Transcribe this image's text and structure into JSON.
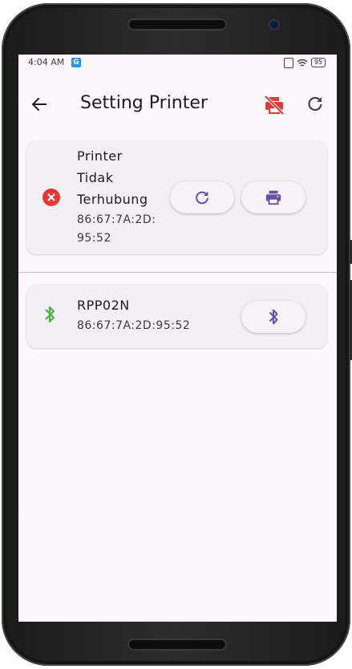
{
  "statusbar": {
    "time": "4:04 AM",
    "g_label": "G",
    "battery": "95"
  },
  "appbar": {
    "title": "Setting Printer"
  },
  "current_printer": {
    "status_lines": [
      "Printer",
      "Tidak",
      "Terhubung"
    ],
    "mac_line1": "86:67:7A:2D:",
    "mac_line2": "95:52"
  },
  "devices": [
    {
      "name": "RPP02N",
      "mac": "86:67:7A:2D:95:52"
    }
  ],
  "colors": {
    "accent": "#6750a4",
    "error": "#e53935",
    "bluetooth_green": "#4caf50",
    "background": "#fdf8fd",
    "card": "#f4eff4"
  },
  "icons": {
    "back": "arrow-left-icon",
    "no_printer": "print-disabled-icon",
    "refresh": "refresh-icon",
    "status": "error-circle-icon",
    "reconnect": "refresh-icon",
    "print": "printer-icon",
    "bluetooth": "bluetooth-icon"
  }
}
